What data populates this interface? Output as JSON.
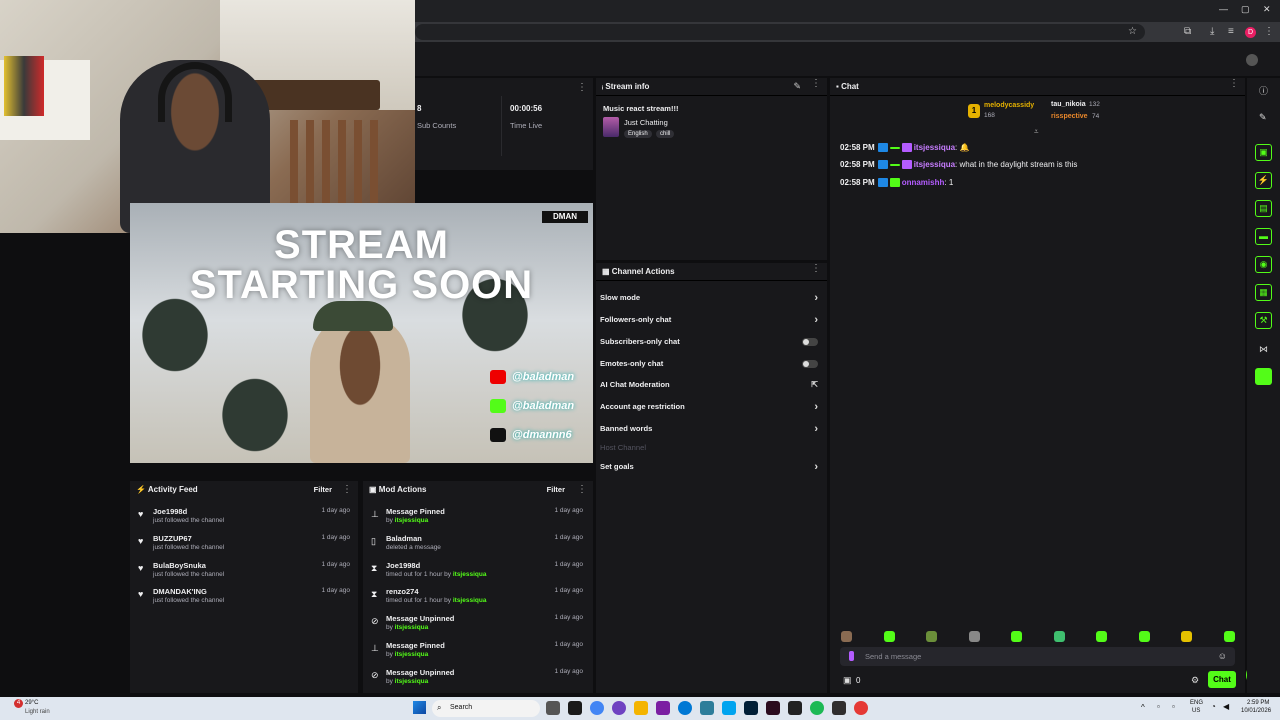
{
  "browser": {
    "window_controls": [
      "—",
      "▢",
      "✕"
    ],
    "profile_initial": "D"
  },
  "stats": {
    "sub_counts_value": "8",
    "sub_counts_label": "Sub Counts",
    "time_live_value": "00:00:56",
    "time_live_label": "Time Live"
  },
  "preview": {
    "title_line1": "STREAM",
    "title_line2": "STARTING SOON",
    "logo": "DMAN",
    "socials": [
      "@baladman",
      "@baladman",
      "@dmannn6"
    ]
  },
  "stream_info": {
    "header": "Stream info",
    "title": "Music react stream!!!",
    "category": "Just Chatting",
    "tags": [
      "English",
      "chill"
    ]
  },
  "channel_actions": {
    "header": "Channel Actions",
    "items": [
      {
        "label": "Slow mode",
        "control": "arrow"
      },
      {
        "label": "Followers-only chat",
        "control": "arrow"
      },
      {
        "label": "Subscribers-only chat",
        "control": "toggle"
      },
      {
        "label": "Emotes-only chat",
        "control": "toggle"
      },
      {
        "label": "AI Chat Moderation",
        "control": "external"
      },
      {
        "label": "Account age restriction",
        "control": "arrow"
      },
      {
        "label": "Banned words",
        "control": "arrow"
      },
      {
        "label": "Host Channel",
        "control": "disabled"
      },
      {
        "label": "Set goals",
        "control": "arrow"
      }
    ]
  },
  "chat": {
    "header": "Chat",
    "leaderboard": [
      {
        "rank": "1",
        "name": "melodycassidy",
        "count": "168"
      },
      {
        "name": "tau_nikoia",
        "count": "132"
      },
      {
        "name": "risspective",
        "count": "74"
      }
    ],
    "messages": [
      {
        "time": "02:58 PM",
        "user": "itsjessiqua",
        "text": ""
      },
      {
        "time": "02:58 PM",
        "user": "itsjessiqua",
        "text": "what in the daylight stream is this"
      },
      {
        "time": "02:58 PM",
        "user": "onnamishh",
        "text": "1"
      }
    ],
    "input_placeholder": "Send a message",
    "viewer_count": "0",
    "send_label": "Chat"
  },
  "activity_feed": {
    "header": "Activity Feed",
    "filter": "Filter",
    "items": [
      {
        "name": "Joe1998d",
        "sub": "just followed the channel",
        "date": "1 day ago"
      },
      {
        "name": "BUZZUP67",
        "sub": "just followed the channel",
        "date": "1 day ago"
      },
      {
        "name": "BulaBoySnuka",
        "sub": "just followed the channel",
        "date": "1 day ago"
      },
      {
        "name": "DMANDAK'ING",
        "sub": "just followed the channel",
        "date": "1 day ago"
      }
    ]
  },
  "mod_actions": {
    "header": "Mod Actions",
    "filter": "Filter",
    "items": [
      {
        "name": "Message Pinned",
        "sub_prefix": "by ",
        "sub_user": "itsjessiqua",
        "date": "1 day ago",
        "icon": "📌"
      },
      {
        "name": "Baladman",
        "sub_prefix": "deleted a message",
        "sub_user": "",
        "date": "1 day ago",
        "icon": "🗑"
      },
      {
        "name": "Joe1998d",
        "sub_prefix": "timed out for 1 hour by ",
        "sub_user": "itsjessiqua",
        "date": "1 day ago",
        "icon": "⌛"
      },
      {
        "name": "renzo274",
        "sub_prefix": "timed out for 1 hour by ",
        "sub_user": "itsjessiqua",
        "date": "1 day ago",
        "icon": "⌛"
      },
      {
        "name": "Message Unpinned",
        "sub_prefix": "by ",
        "sub_user": "itsjessiqua",
        "date": "1 day ago",
        "icon": "⊘"
      },
      {
        "name": "Message Pinned",
        "sub_prefix": "by ",
        "sub_user": "itsjessiqua",
        "date": "1 day ago",
        "icon": "📌"
      },
      {
        "name": "Message Unpinned",
        "sub_prefix": "by ",
        "sub_user": "itsjessiqua",
        "date": "1 day ago",
        "icon": "⊘"
      }
    ]
  },
  "taskbar": {
    "weather_temp": "29°C",
    "weather_desc": "Light rain",
    "search": "Search",
    "lang_top": "ENG",
    "lang_bottom": "US",
    "time": "2:59 PM",
    "date": "10/01/2026",
    "weather_badge": "4"
  }
}
